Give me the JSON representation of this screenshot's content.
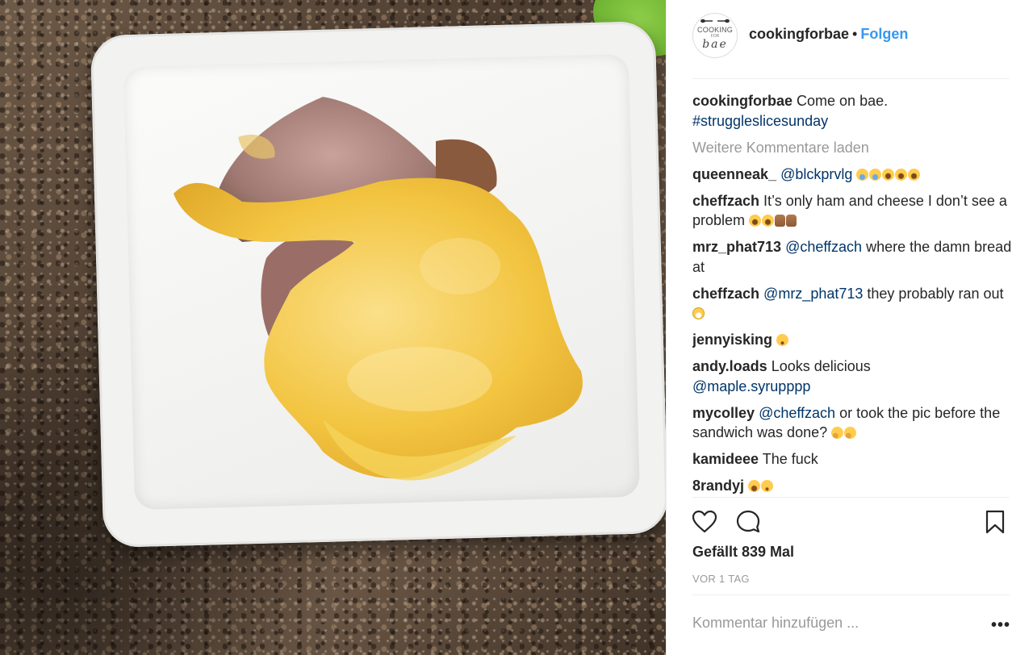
{
  "header": {
    "avatar_lines": [
      "COOKING",
      "FOR",
      "bae"
    ],
    "username": "cookingforbae",
    "separator": "•",
    "follow_label": "Folgen"
  },
  "caption": {
    "username": "cookingforbae",
    "text": "Come on bae.",
    "hashtag": "#struggleslicesunday"
  },
  "load_more_label": "Weitere Kommentare laden",
  "comments": [
    {
      "user": "queenneak_",
      "mention": "@blckprvlg",
      "text": "",
      "emojis": [
        "sob",
        "sob",
        "joy",
        "joy",
        "joy"
      ]
    },
    {
      "user": "cheffzach",
      "mention": "",
      "text": "It’s only ham and cheese I don’t see a problem",
      "emojis": [
        "joy",
        "joy",
        "thumb",
        "thumb"
      ]
    },
    {
      "user": "mrz_phat713",
      "mention": "@cheffzach",
      "text": "where the damn bread at",
      "emojis": []
    },
    {
      "user": "cheffzach",
      "mention": "@mrz_phat713",
      "text": "they probably ran out",
      "emojis": [
        "grin"
      ]
    },
    {
      "user": "jennyisking",
      "mention": "",
      "text": "",
      "emojis": [
        "unamused"
      ]
    },
    {
      "user": "andy.loads",
      "mention": "",
      "text": "Looks delicious",
      "trailing_mention": "@maple.syrupppp",
      "emojis": []
    },
    {
      "user": "mycolley",
      "mention": "@cheffzach",
      "text": "or took the pic before the sandwich was done?",
      "emojis": [
        "thinking",
        "thinking"
      ]
    },
    {
      "user": "kamideee",
      "mention": "",
      "text": "The fuck",
      "emojis": []
    },
    {
      "user": "8randyj",
      "mention": "",
      "text": "",
      "emojis": [
        "tired",
        "unamused"
      ]
    }
  ],
  "actions": {
    "like_icon": "heart-icon",
    "comment_icon": "speech-bubble-icon",
    "save_icon": "bookmark-icon"
  },
  "likes_text": "Gefällt 839 Mal",
  "timestamp": "VOR 1 TAG",
  "comment_input": {
    "placeholder": "Kommentar hinzufügen ...",
    "more_label": "•••"
  },
  "colors": {
    "link": "#3897f0",
    "mention": "#003569",
    "muted": "#999999",
    "text": "#262626"
  }
}
